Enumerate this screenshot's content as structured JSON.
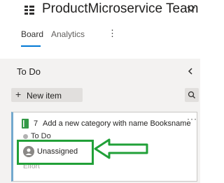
{
  "header": {
    "team_name": "ProductMicroservice Team",
    "tabs": [
      {
        "label": "Board",
        "active": true
      },
      {
        "label": "Analytics",
        "active": false
      }
    ],
    "more_glyph": "⋮"
  },
  "column": {
    "title": "To Do",
    "new_item_label": "New item",
    "new_item_glyph": "+"
  },
  "card": {
    "id": "7",
    "title": "Add a new category with name Booksname",
    "state": "To Do",
    "assignee": "Unassigned",
    "effort_label": "Effort",
    "more_glyph": "···"
  },
  "annotation": {
    "highlight_color": "#21a038"
  },
  "colors": {
    "accent": "#0078d4",
    "card_stripe": "#73a9ce",
    "board_bg": "#f3f2f1"
  }
}
